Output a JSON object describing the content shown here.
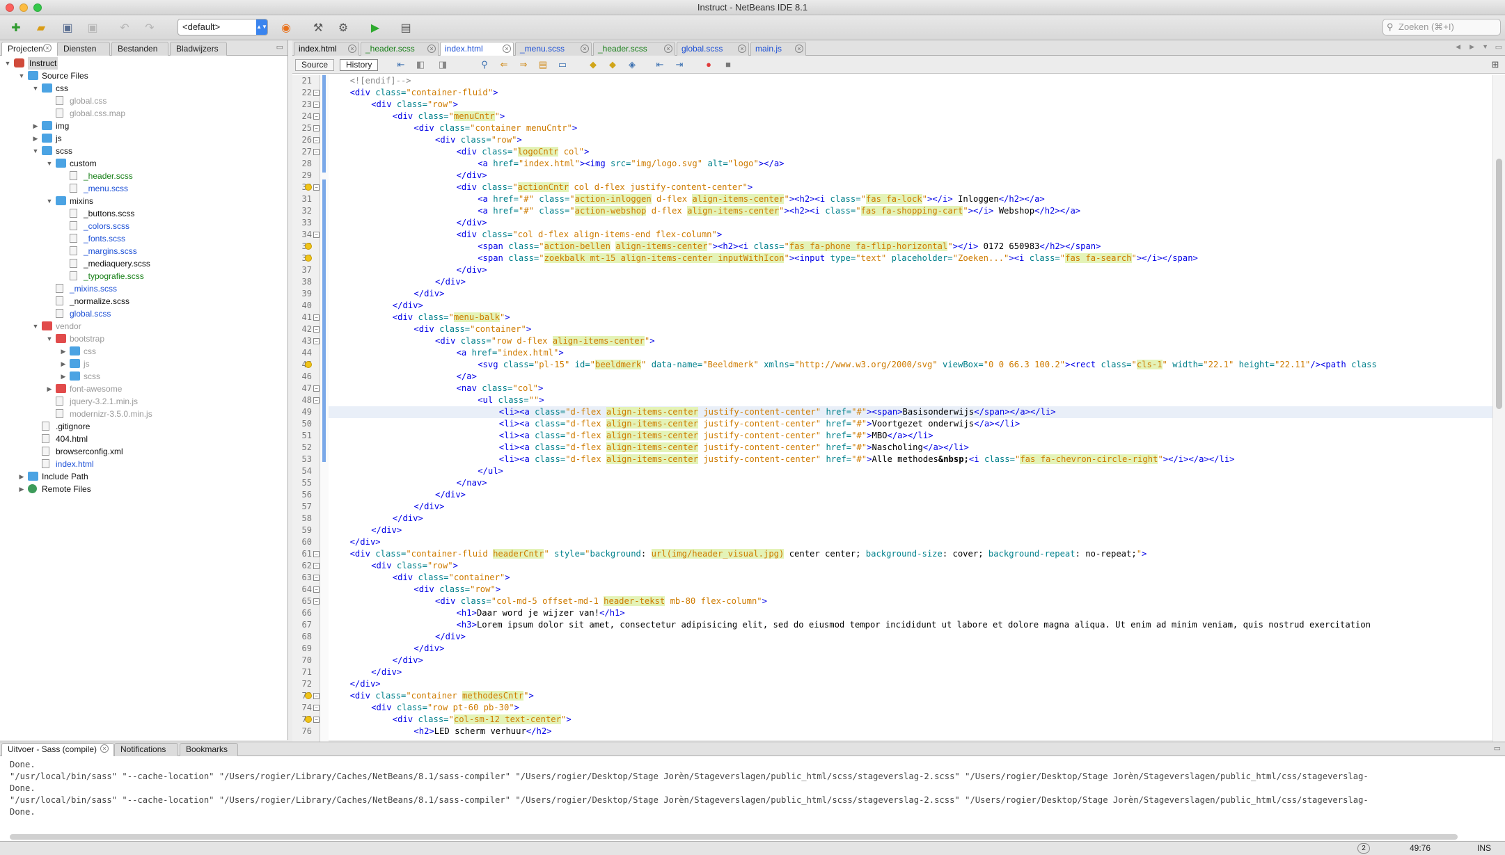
{
  "window": {
    "title": "Instruct - NetBeans IDE 8.1"
  },
  "toolbar": {
    "config": "<default>",
    "search_placeholder": "Zoeken (⌘+I)"
  },
  "left_tabs": [
    "Projecten",
    "Diensten",
    "Bestanden",
    "Bladwijzers"
  ],
  "tree": [
    {
      "d": 0,
      "tog": "▼",
      "label": "Instruct",
      "color": "c-black",
      "icon": "project"
    },
    {
      "d": 1,
      "tog": "▼",
      "label": "Source Files",
      "color": "c-black",
      "icon": "folder"
    },
    {
      "d": 2,
      "tog": "▼",
      "label": "css",
      "color": "c-black",
      "icon": "folder"
    },
    {
      "d": 3,
      "tog": "",
      "label": "global.css",
      "color": "c-grey",
      "icon": "file"
    },
    {
      "d": 3,
      "tog": "",
      "label": "global.css.map",
      "color": "c-grey",
      "icon": "file"
    },
    {
      "d": 2,
      "tog": "▶",
      "label": "img",
      "color": "c-black",
      "icon": "folder"
    },
    {
      "d": 2,
      "tog": "▶",
      "label": "js",
      "color": "c-black",
      "icon": "folder"
    },
    {
      "d": 2,
      "tog": "▼",
      "label": "scss",
      "color": "c-black",
      "icon": "folder"
    },
    {
      "d": 3,
      "tog": "▼",
      "label": "custom",
      "color": "c-black",
      "icon": "folder"
    },
    {
      "d": 4,
      "tog": "",
      "label": "_header.scss",
      "color": "c-green",
      "icon": "file"
    },
    {
      "d": 4,
      "tog": "",
      "label": "_menu.scss",
      "color": "c-blue",
      "icon": "file"
    },
    {
      "d": 3,
      "tog": "▼",
      "label": "mixins",
      "color": "c-black",
      "icon": "folder"
    },
    {
      "d": 4,
      "tog": "",
      "label": "_buttons.scss",
      "color": "c-black",
      "icon": "file"
    },
    {
      "d": 4,
      "tog": "",
      "label": "_colors.scss",
      "color": "c-blue",
      "icon": "file"
    },
    {
      "d": 4,
      "tog": "",
      "label": "_fonts.scss",
      "color": "c-blue",
      "icon": "file"
    },
    {
      "d": 4,
      "tog": "",
      "label": "_margins.scss",
      "color": "c-blue",
      "icon": "file"
    },
    {
      "d": 4,
      "tog": "",
      "label": "_mediaquery.scss",
      "color": "c-black",
      "icon": "file"
    },
    {
      "d": 4,
      "tog": "",
      "label": "_typografie.scss",
      "color": "c-green",
      "icon": "file"
    },
    {
      "d": 3,
      "tog": "",
      "label": "_mixins.scss",
      "color": "c-blue",
      "icon": "file"
    },
    {
      "d": 3,
      "tog": "",
      "label": "_normalize.scss",
      "color": "c-black",
      "icon": "file"
    },
    {
      "d": 3,
      "tog": "",
      "label": "global.scss",
      "color": "c-blue",
      "icon": "file"
    },
    {
      "d": 2,
      "tog": "▼",
      "label": "vendor",
      "color": "c-grey",
      "icon": "folder-red"
    },
    {
      "d": 3,
      "tog": "▼",
      "label": "bootstrap",
      "color": "c-grey",
      "icon": "folder-red"
    },
    {
      "d": 4,
      "tog": "▶",
      "label": "css",
      "color": "c-grey",
      "icon": "folder"
    },
    {
      "d": 4,
      "tog": "▶",
      "label": "js",
      "color": "c-grey",
      "icon": "folder"
    },
    {
      "d": 4,
      "tog": "▶",
      "label": "scss",
      "color": "c-grey",
      "icon": "folder"
    },
    {
      "d": 3,
      "tog": "▶",
      "label": "font-awesome",
      "color": "c-grey",
      "icon": "folder-red"
    },
    {
      "d": 3,
      "tog": "",
      "label": "jquery-3.2.1.min.js",
      "color": "c-grey",
      "icon": "file"
    },
    {
      "d": 3,
      "tog": "",
      "label": "modernizr-3.5.0.min.js",
      "color": "c-grey",
      "icon": "file"
    },
    {
      "d": 2,
      "tog": "",
      "label": ".gitignore",
      "color": "c-black",
      "icon": "file"
    },
    {
      "d": 2,
      "tog": "",
      "label": "404.html",
      "color": "c-black",
      "icon": "file"
    },
    {
      "d": 2,
      "tog": "",
      "label": "browserconfig.xml",
      "color": "c-black",
      "icon": "file"
    },
    {
      "d": 2,
      "tog": "",
      "label": "index.html",
      "color": "c-blue",
      "icon": "file"
    },
    {
      "d": 1,
      "tog": "▶",
      "label": "Include Path",
      "color": "c-black",
      "icon": "folder"
    },
    {
      "d": 1,
      "tog": "▶",
      "label": "Remote Files",
      "color": "c-black",
      "icon": "globe"
    }
  ],
  "editor_tabs": [
    {
      "label": "index.html",
      "color": "#000",
      "active": false
    },
    {
      "label": "_header.scss",
      "color": "#188018",
      "active": false
    },
    {
      "label": "index.html",
      "color": "#1b4fd6",
      "active": true
    },
    {
      "label": "_menu.scss",
      "color": "#1b4fd6",
      "active": false
    },
    {
      "label": "_header.scss",
      "color": "#188018",
      "active": false
    },
    {
      "label": "global.scss",
      "color": "#1b4fd6",
      "active": false
    },
    {
      "label": "main.js",
      "color": "#1b4fd6",
      "active": false
    }
  ],
  "editor_toolbar": {
    "source": "Source",
    "history": "History"
  },
  "code_lines": [
    {
      "n": "21",
      "h": "<span class=\"cm\">&lt;![endif]--&gt;</span>",
      "i": 4
    },
    {
      "n": "22",
      "h": "<span class=\"t\">&lt;div</span> <span class=\"a\">class=</span><span class=\"v\">\"container-fluid\"</span><span class=\"t\">&gt;</span>",
      "i": 4
    },
    {
      "n": "23",
      "h": "<span class=\"t\">&lt;div</span> <span class=\"a\">class=</span><span class=\"v\">\"row\"</span><span class=\"t\">&gt;</span>",
      "i": 8
    },
    {
      "n": "24",
      "h": "<span class=\"t\">&lt;div</span> <span class=\"a\">class=</span><span class=\"v\">\"<span class=\"hlw\">menuCntr</span>\"</span><span class=\"t\">&gt;</span>",
      "i": 12
    },
    {
      "n": "25",
      "h": "<span class=\"t\">&lt;div</span> <span class=\"a\">class=</span><span class=\"v\">\"container menuCntr\"</span><span class=\"t\">&gt;</span>",
      "i": 16
    },
    {
      "n": "26",
      "h": "<span class=\"t\">&lt;div</span> <span class=\"a\">class=</span><span class=\"v\">\"row\"</span><span class=\"t\">&gt;</span>",
      "i": 20
    },
    {
      "n": "27",
      "h": "<span class=\"t\">&lt;div</span> <span class=\"a\">class=</span><span class=\"v\">\"<span class=\"hlw\">logoCntr</span> col\"</span><span class=\"t\">&gt;</span>",
      "i": 24
    },
    {
      "n": "28",
      "h": "<span class=\"t\">&lt;a</span> <span class=\"a\">href=</span><span class=\"v\">\"index.html\"</span><span class=\"t\">&gt;&lt;img</span> <span class=\"a\">src=</span><span class=\"v\">\"img/logo.svg\"</span> <span class=\"a\">alt=</span><span class=\"v\">\"logo\"</span><span class=\"t\">&gt;&lt;/a&gt;</span>",
      "i": 28
    },
    {
      "n": "29",
      "h": "<span class=\"t\">&lt;/div&gt;</span>",
      "i": 24
    },
    {
      "n": "30",
      "h": "<span class=\"t\">&lt;div</span> <span class=\"a\">class=</span><span class=\"v\">\"<span class=\"hlw\">actionCntr</span> col d-flex justify-content-center\"</span><span class=\"t\">&gt;</span>",
      "i": 24
    },
    {
      "n": "31",
      "h": "<span class=\"t\">&lt;a</span> <span class=\"a\">href=</span><span class=\"v\">\"#\"</span> <span class=\"a\">class=</span><span class=\"v\">\"<span class=\"hlw\">action-inloggen</span> d-flex <span class=\"hlw\">align-items-center</span>\"</span><span class=\"t\">&gt;&lt;h2&gt;&lt;i</span> <span class=\"a\">class=</span><span class=\"v\">\"<span class=\"hlw\">fas fa-lock</span>\"</span><span class=\"t\">&gt;&lt;/i&gt;</span> Inloggen<span class=\"t\">&lt;/h2&gt;&lt;/a&gt;</span>",
      "i": 28
    },
    {
      "n": "32",
      "h": "<span class=\"t\">&lt;a</span> <span class=\"a\">href=</span><span class=\"v\">\"#\"</span> <span class=\"a\">class=</span><span class=\"v\">\"<span class=\"hlw\">action-webshop</span> d-flex <span class=\"hlw\">align-items-center</span>\"</span><span class=\"t\">&gt;&lt;h2&gt;&lt;i</span> <span class=\"a\">class=</span><span class=\"v\">\"<span class=\"hlw\">fas fa-shopping-cart</span>\"</span><span class=\"t\">&gt;&lt;/i&gt;</span> Webshop<span class=\"t\">&lt;/h2&gt;&lt;/a&gt;</span>",
      "i": 28
    },
    {
      "n": "33",
      "h": "<span class=\"t\">&lt;/div&gt;</span>",
      "i": 24
    },
    {
      "n": "34",
      "h": "<span class=\"t\">&lt;div</span> <span class=\"a\">class=</span><span class=\"v\">\"col d-flex align-items-end flex-column\"</span><span class=\"t\">&gt;</span>",
      "i": 24
    },
    {
      "n": "35",
      "h": "<span class=\"t\">&lt;span</span> <span class=\"a\">class=</span><span class=\"v\">\"<span class=\"hlw\">action-bellen</span> <span class=\"hlw\">align-items-center</span>\"</span><span class=\"t\">&gt;&lt;h2&gt;&lt;i</span> <span class=\"a\">class=</span><span class=\"v\">\"<span class=\"hlw\">fas fa-phone fa-flip-horizontal</span>\"</span><span class=\"t\">&gt;&lt;/i&gt;</span> 0172 650983<span class=\"t\">&lt;/h2&gt;&lt;/span&gt;</span>",
      "i": 28
    },
    {
      "n": "36",
      "h": "<span class=\"t\">&lt;span</span> <span class=\"a\">class=</span><span class=\"v\">\"<span class=\"hlw\">zoekbalk mt-15 align-items-center inputWithIcon</span>\"</span><span class=\"t\">&gt;&lt;input</span> <span class=\"a\">type=</span><span class=\"v\">\"text\"</span> <span class=\"a\">placeholder=</span><span class=\"v\">\"Zoeken...\"</span><span class=\"t\">&gt;&lt;i</span> <span class=\"a\">class=</span><span class=\"v\">\"<span class=\"hlw\">fas fa-search</span>\"</span><span class=\"t\">&gt;&lt;/i&gt;&lt;/span&gt;</span>",
      "i": 28
    },
    {
      "n": "37",
      "h": "<span class=\"t\">&lt;/div&gt;</span>",
      "i": 24
    },
    {
      "n": "38",
      "h": "<span class=\"t\">&lt;/div&gt;</span>",
      "i": 20
    },
    {
      "n": "39",
      "h": "<span class=\"t\">&lt;/div&gt;</span>",
      "i": 16
    },
    {
      "n": "40",
      "h": "<span class=\"t\">&lt;/div&gt;</span>",
      "i": 12
    },
    {
      "n": "41",
      "h": "<span class=\"t\">&lt;div</span> <span class=\"a\">class=</span><span class=\"v\">\"<span class=\"hlw\">menu-balk</span>\"</span><span class=\"t\">&gt;</span>",
      "i": 12
    },
    {
      "n": "42",
      "h": "<span class=\"t\">&lt;div</span> <span class=\"a\">class=</span><span class=\"v\">\"container\"</span><span class=\"t\">&gt;</span>",
      "i": 16
    },
    {
      "n": "43",
      "h": "<span class=\"t\">&lt;div</span> <span class=\"a\">class=</span><span class=\"v\">\"row d-flex <span class=\"hlw\">align-items-center</span>\"</span><span class=\"t\">&gt;</span>",
      "i": 20
    },
    {
      "n": "44",
      "h": "<span class=\"t\">&lt;a</span> <span class=\"a\">href=</span><span class=\"v\">\"index.html\"</span><span class=\"t\">&gt;</span>",
      "i": 24
    },
    {
      "n": "45",
      "h": "<span class=\"t\">&lt;svg</span> <span class=\"a\">class=</span><span class=\"v\">\"pl-15\"</span> <span class=\"a\">id=</span><span class=\"v\">\"<span class=\"hlw\">beeldmerk</span>\"</span> <span class=\"a\">data-name=</span><span class=\"v\">\"Beeldmerk\"</span> <span class=\"a\">xmlns=</span><span class=\"v\">\"http://www.w3.org/2000/svg\"</span> <span class=\"a\">viewBox=</span><span class=\"v\">\"0 0 66.3 100.2\"</span><span class=\"t\">&gt;&lt;rect</span> <span class=\"a\">class=</span><span class=\"v\">\"<span class=\"hlw\">cls-1</span>\"</span> <span class=\"a\">width=</span><span class=\"v\">\"22.1\"</span> <span class=\"a\">height=</span><span class=\"v\">\"22.11\"</span><span class=\"t\">/&gt;&lt;path</span> <span class=\"a\">class</span>",
      "i": 28
    },
    {
      "n": "46",
      "h": "<span class=\"t\">&lt;/a&gt;</span>",
      "i": 24
    },
    {
      "n": "47",
      "h": "<span class=\"t\">&lt;nav</span> <span class=\"a\">class=</span><span class=\"v\">\"col\"</span><span class=\"t\">&gt;</span>",
      "i": 24
    },
    {
      "n": "48",
      "h": "<span class=\"t\">&lt;ul</span> <span class=\"a\">class=</span><span class=\"v\">\"\"</span><span class=\"t\">&gt;</span>",
      "i": 28
    },
    {
      "n": "49",
      "h": "<span class=\"t\">&lt;li&gt;&lt;a</span> <span class=\"a\">class=</span><span class=\"v\">\"d-flex <span class=\"hlw\">align-items-center</span> justify-content-center\"</span> <span class=\"a\">href=</span><span class=\"v\">\"#\"</span><span class=\"t\">&gt;&lt;span&gt;</span>Basisonderwijs<span class=\"t\">&lt;/span&gt;&lt;/a&gt;&lt;/li&gt;</span>",
      "i": 32,
      "hl": true
    },
    {
      "n": "50",
      "h": "<span class=\"t\">&lt;li&gt;&lt;a</span> <span class=\"a\">class=</span><span class=\"v\">\"d-flex <span class=\"hlw\">align-items-center</span> justify-content-center\"</span> <span class=\"a\">href=</span><span class=\"v\">\"#\"</span><span class=\"t\">&gt;</span>Voortgezet onderwijs<span class=\"t\">&lt;/a&gt;&lt;/li&gt;</span>",
      "i": 32
    },
    {
      "n": "51",
      "h": "<span class=\"t\">&lt;li&gt;&lt;a</span> <span class=\"a\">class=</span><span class=\"v\">\"d-flex <span class=\"hlw\">align-items-center</span> justify-content-center\"</span> <span class=\"a\">href=</span><span class=\"v\">\"#\"</span><span class=\"t\">&gt;</span>MBO<span class=\"t\">&lt;/a&gt;&lt;/li&gt;</span>",
      "i": 32
    },
    {
      "n": "52",
      "h": "<span class=\"t\">&lt;li&gt;&lt;a</span> <span class=\"a\">class=</span><span class=\"v\">\"d-flex <span class=\"hlw\">align-items-center</span> justify-content-center\"</span> <span class=\"a\">href=</span><span class=\"v\">\"#\"</span><span class=\"t\">&gt;</span>Nascholing<span class=\"t\">&lt;/a&gt;&lt;/li&gt;</span>",
      "i": 32
    },
    {
      "n": "53",
      "h": "<span class=\"t\">&lt;li&gt;&lt;a</span> <span class=\"a\">class=</span><span class=\"v\">\"d-flex <span class=\"hlw\">align-items-center</span> justify-content-center\"</span> <span class=\"a\">href=</span><span class=\"v\">\"#\"</span><span class=\"t\">&gt;</span>Alle methodes<b>&amp;nbsp;</b><span class=\"t\">&lt;i</span> <span class=\"a\">class=</span><span class=\"v\">\"<span class=\"hlw\">fas fa-chevron-circle-right</span>\"</span><span class=\"t\">&gt;&lt;/i&gt;&lt;/a&gt;&lt;/li&gt;</span>",
      "i": 32
    },
    {
      "n": "54",
      "h": "<span class=\"t\">&lt;/ul&gt;</span>",
      "i": 28
    },
    {
      "n": "55",
      "h": "<span class=\"t\">&lt;/nav&gt;</span>",
      "i": 24
    },
    {
      "n": "56",
      "h": "<span class=\"t\">&lt;/div&gt;</span>",
      "i": 20
    },
    {
      "n": "57",
      "h": "<span class=\"t\">&lt;/div&gt;</span>",
      "i": 16
    },
    {
      "n": "58",
      "h": "<span class=\"t\">&lt;/div&gt;</span>",
      "i": 12
    },
    {
      "n": "59",
      "h": "<span class=\"t\">&lt;/div&gt;</span>",
      "i": 8
    },
    {
      "n": "60",
      "h": "<span class=\"t\">&lt;/div&gt;</span>",
      "i": 4
    },
    {
      "n": "61",
      "h": "<span class=\"t\">&lt;div</span> <span class=\"a\">class=</span><span class=\"v\">\"container-fluid <span class=\"hlw\">headerCntr</span>\"</span> <span class=\"a\">style=</span><span class=\"v\">\"</span><span class=\"a\">background</span>: <span class=\"v\"><span class=\"hlw\">url(img/header_visual.jpg)</span></span> center center; <span class=\"a\">background-size</span>: cover; <span class=\"a\">background-repeat</span>: no-repeat;<span class=\"v\">\"</span><span class=\"t\">&gt;</span>",
      "i": 4
    },
    {
      "n": "62",
      "h": "<span class=\"t\">&lt;div</span> <span class=\"a\">class=</span><span class=\"v\">\"row\"</span><span class=\"t\">&gt;</span>",
      "i": 8
    },
    {
      "n": "63",
      "h": "<span class=\"t\">&lt;div</span> <span class=\"a\">class=</span><span class=\"v\">\"container\"</span><span class=\"t\">&gt;</span>",
      "i": 12
    },
    {
      "n": "64",
      "h": "<span class=\"t\">&lt;div</span> <span class=\"a\">class=</span><span class=\"v\">\"row\"</span><span class=\"t\">&gt;</span>",
      "i": 16
    },
    {
      "n": "65",
      "h": "<span class=\"t\">&lt;div</span> <span class=\"a\">class=</span><span class=\"v\">\"col-md-5 offset-md-1 <span class=\"hlw\">header-tekst</span> mb-80 flex-column\"</span><span class=\"t\">&gt;</span>",
      "i": 20
    },
    {
      "n": "66",
      "h": "<span class=\"t\">&lt;h1&gt;</span>Daar word je wijzer van!<span class=\"t\">&lt;/h1&gt;</span>",
      "i": 24
    },
    {
      "n": "67",
      "h": "<span class=\"t\">&lt;h3&gt;</span>Lorem ipsum dolor sit amet, consectetur adipisicing elit, sed do eiusmod tempor incididunt ut labore et dolore magna aliqua. Ut enim ad minim veniam, quis nostrud exercitation",
      "i": 24
    },
    {
      "n": "68",
      "h": "<span class=\"t\">&lt;/div&gt;</span>",
      "i": 20
    },
    {
      "n": "69",
      "h": "<span class=\"t\">&lt;/div&gt;</span>",
      "i": 16
    },
    {
      "n": "70",
      "h": "<span class=\"t\">&lt;/div&gt;</span>",
      "i": 12
    },
    {
      "n": "71",
      "h": "<span class=\"t\">&lt;/div&gt;</span>",
      "i": 8
    },
    {
      "n": "72",
      "h": "<span class=\"t\">&lt;/div&gt;</span>",
      "i": 4
    },
    {
      "n": "73",
      "h": "<span class=\"t\">&lt;div</span> <span class=\"a\">class=</span><span class=\"v\">\"container <span class=\"hlw\">methodesCntr</span>\"</span><span class=\"t\">&gt;</span>",
      "i": 4
    },
    {
      "n": "74",
      "h": "<span class=\"t\">&lt;div</span> <span class=\"a\">class=</span><span class=\"v\">\"row pt-60 pb-30\"</span><span class=\"t\">&gt;</span>",
      "i": 8
    },
    {
      "n": "75",
      "h": "<span class=\"t\">&lt;div</span> <span class=\"a\">class=</span><span class=\"v\">\"<span class=\"hlw\">col-sm-12 text-center</span>\"</span><span class=\"t\">&gt;</span>",
      "i": 12
    },
    {
      "n": "76",
      "h": "<span class=\"t\">&lt;h2&gt;</span>LED scherm verhuur<span class=\"t\">&lt;/h2&gt;</span>",
      "i": 16
    }
  ],
  "bottom_tabs": [
    "Uitvoer - Sass (compile)",
    "Notifications",
    "Bookmarks"
  ],
  "output_lines": [
    "Done.",
    "\"/usr/local/bin/sass\" \"--cache-location\" \"/Users/rogier/Library/Caches/NetBeans/8.1/sass-compiler\" \"/Users/rogier/Desktop/Stage Jorèn/Stageverslagen/public_html/scss/stageverslag-2.scss\" \"/Users/rogier/Desktop/Stage Jorèn/Stageverslagen/public_html/css/stageverslag-",
    "Done.",
    "\"/usr/local/bin/sass\" \"--cache-location\" \"/Users/rogier/Library/Caches/NetBeans/8.1/sass-compiler\" \"/Users/rogier/Desktop/Stage Jorèn/Stageverslagen/public_html/scss/stageverslag-2.scss\" \"/Users/rogier/Desktop/Stage Jorèn/Stageverslagen/public_html/css/stageverslag-",
    "Done."
  ],
  "status": {
    "badge": "2",
    "position": "49:76",
    "mode": "INS"
  }
}
